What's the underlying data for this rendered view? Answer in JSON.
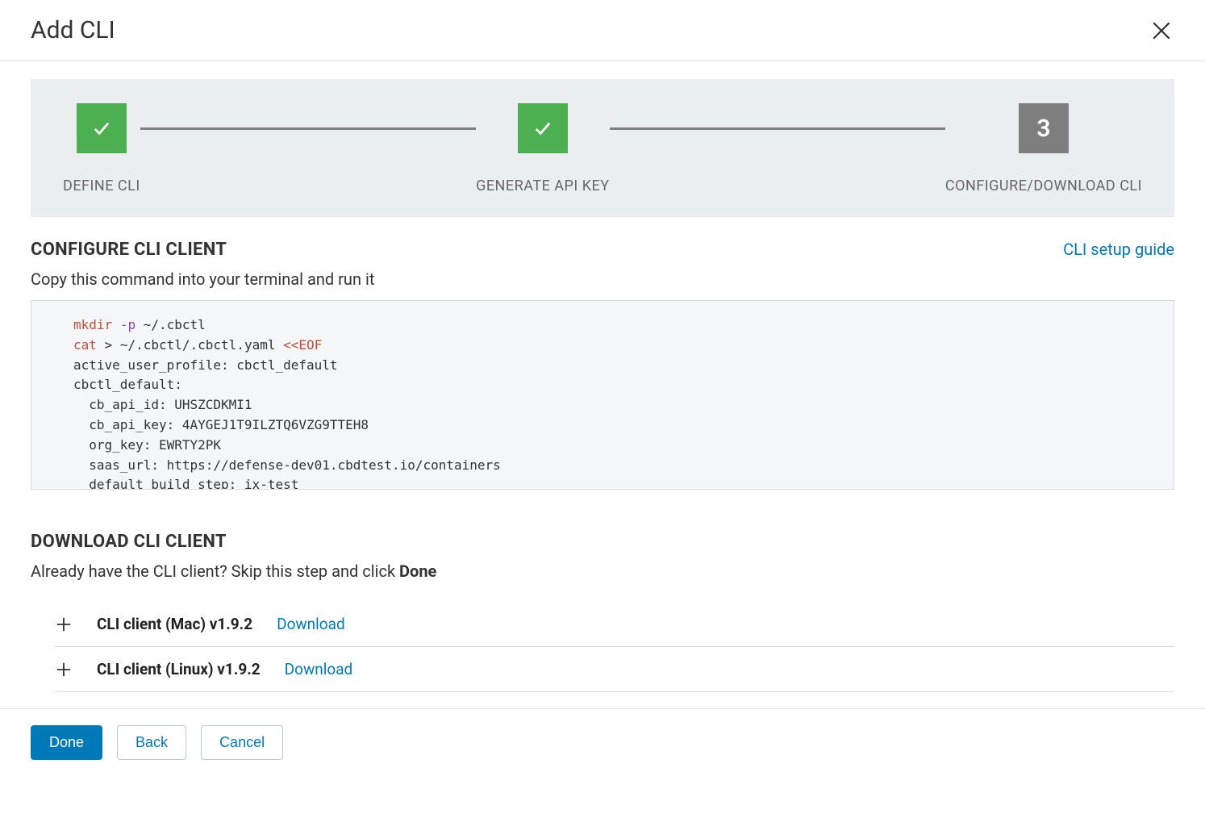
{
  "header": {
    "title": "Add CLI"
  },
  "stepper": {
    "steps": [
      {
        "label": "DEFINE CLI",
        "state": "done"
      },
      {
        "label": "GENERATE API KEY",
        "state": "done"
      },
      {
        "label": "CONFIGURE/DOWNLOAD CLI",
        "state": "current",
        "number": "3"
      }
    ]
  },
  "configure": {
    "title": "CONFIGURE CLI CLIENT",
    "guide_link": "CLI setup guide",
    "subtitle": "Copy this command into your terminal and run it",
    "code": {
      "line1_cmd": "mkdir",
      "line1_flag": "-p",
      "line1_rest": " ~/.cbctl",
      "line2_cmd": "cat",
      "line2_op": " > ",
      "line2_path": "~/.cbctl/.cbctl.yaml ",
      "line2_heredoc": "<<EOF",
      "body": "active_user_profile: cbctl_default\ncbctl_default:\n  cb_api_id: UHSZCDKMI1\n  cb_api_key: 4AYGEJ1T9ILZTQ6VZG9TTEH8\n  org_key: EWRTY2PK\n  saas_url: https://defense-dev01.cbdtest.io/containers\n  default_build_step: ix-test\nEOF"
    }
  },
  "download": {
    "title": "DOWNLOAD CLI CLIENT",
    "intro_prefix": "Already have the CLI client? Skip this step and click ",
    "intro_bold": "Done",
    "items": [
      {
        "label": "CLI client (Mac) v1.9.2",
        "action": "Download"
      },
      {
        "label": "CLI client (Linux) v1.9.2",
        "action": "Download"
      }
    ]
  },
  "footer": {
    "done": "Done",
    "back": "Back",
    "cancel": "Cancel"
  }
}
